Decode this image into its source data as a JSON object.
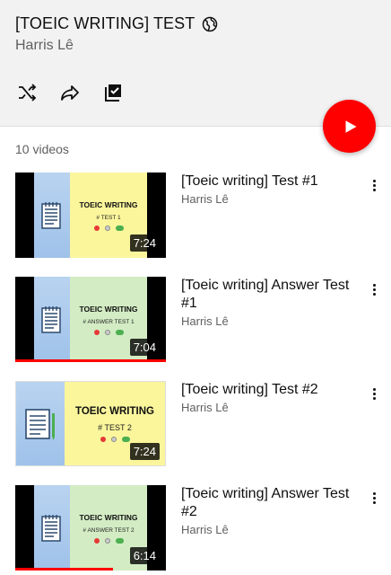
{
  "playlist": {
    "title": "[TOEIC WRITING] TEST",
    "owner": "Harris Lê",
    "video_count": "10 videos"
  },
  "actions": {
    "shuffle_icon": "shuffle-icon",
    "share_icon": "share-icon",
    "save_icon": "save-playlist-icon",
    "play_icon": "play-icon"
  },
  "colors": {
    "accent": "#ff0000",
    "header_bg": "#f2f2f2",
    "thumb_yellow": "#fbf69c",
    "thumb_green": "#d3ecc4"
  },
  "videos": [
    {
      "title": "[Toeic writing] Test #1",
      "channel": "Harris Lê",
      "duration": "7:24",
      "thumb_heading": "TOEIC WRITING",
      "thumb_sub": "# TEST 1",
      "progress": 0
    },
    {
      "title": "[Toeic writing] Answer Test #1",
      "channel": "Harris Lê",
      "duration": "7:04",
      "thumb_heading": "TOEIC WRITING",
      "thumb_sub": "# ANSWER TEST 1",
      "progress": 1.0
    },
    {
      "title": "[Toeic writing] Test #2",
      "channel": "Harris Lê",
      "duration": "7:24",
      "thumb_heading": "TOEIC WRITING",
      "thumb_sub": "# TEST 2",
      "progress": 0
    },
    {
      "title": "[Toeic writing] Answer Test #2",
      "channel": "Harris Lê",
      "duration": "6:14",
      "thumb_heading": "TOEIC WRITING",
      "thumb_sub": "# ANSWER TEST 2",
      "progress": 0.65
    }
  ]
}
